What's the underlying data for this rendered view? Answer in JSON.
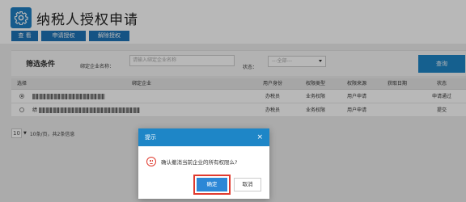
{
  "header": {
    "title": "纳税人授权申请",
    "tabs": [
      "查 看",
      "申请授权",
      "解除授权"
    ]
  },
  "filter": {
    "title": "筛选条件",
    "company_label": "绑定企业名称：",
    "company_placeholder": "请输入绑定企业名称",
    "status_label": "状态：",
    "status_value": "---全部---",
    "query_label": "查询"
  },
  "table": {
    "headers": [
      "选择",
      "绑定企业",
      "用户身份",
      "权限类型",
      "权限来源",
      "获取日期",
      "状态"
    ],
    "rows": [
      {
        "identity": "办税员",
        "perm_type": "业务权限",
        "source": "用户申请",
        "date": "",
        "status": "申请通过",
        "prefix": ""
      },
      {
        "identity": "办税员",
        "perm_type": "业务权限",
        "source": "用户申请",
        "date": "",
        "status": "提交",
        "prefix": "绩"
      }
    ]
  },
  "pager": {
    "page_size": "10",
    "summary": "10条/页，共2条信息"
  },
  "dialog": {
    "title": "提示",
    "close": "×",
    "message": "确认撤消当前企业的所有权限么?",
    "ok_label": "确定",
    "cancel_label": "取消"
  },
  "colors": {
    "primary": "#1e86c7",
    "highlight": "#e03a2e"
  }
}
